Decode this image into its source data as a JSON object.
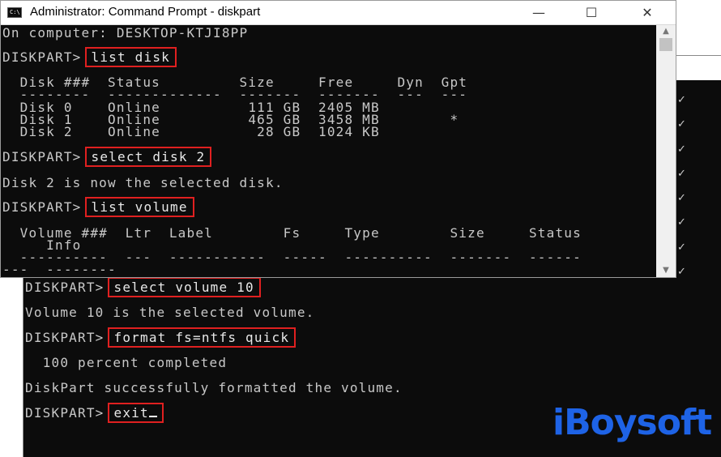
{
  "window": {
    "title": "Administrator: Command Prompt - diskpart",
    "icon_text": "C:\\"
  },
  "console": {
    "computer_line": "On computer: DESKTOP-KTJI8PP",
    "prompt": "DISKPART>",
    "cmd_list_disk": "list disk",
    "disk_table": {
      "header": "  Disk ###  Status         Size     Free     Dyn  Gpt",
      "separator": "  --------  -------------  -------  -------  ---  ---",
      "rows": [
        "  Disk 0    Online          111 GB  2405 MB",
        "  Disk 1    Online          465 GB  3458 MB        *",
        "  Disk 2    Online           28 GB  1024 KB"
      ]
    },
    "cmd_select_disk": "select disk 2",
    "msg_disk_selected": "Disk 2 is now the selected disk.",
    "cmd_list_volume": "list volume",
    "volume_table": {
      "header_1": "  Volume ###  Ltr  Label        Fs     Type        Size     Status",
      "header_2": "     Info",
      "separator_1": "  ----------  ---  -----------  -----  ----------  -------  ------",
      "separator_2": "---  --------"
    },
    "cmd_select_volume": "select volume 10",
    "msg_volume_selected": "Volume 10 is the selected volume.",
    "cmd_format": "format fs=ntfs quick",
    "msg_progress": "  100 percent completed",
    "msg_formatted": "DiskPart successfully formatted the volume.",
    "cmd_exit": "exit"
  },
  "back_window": {
    "checks": [
      "✓",
      "✓",
      "✓",
      "✓",
      "✓",
      "✓",
      "✓",
      "✓"
    ]
  },
  "logo": {
    "text": "iBoysoft"
  },
  "colors": {
    "console_bg": "#0c0c0c",
    "console_text": "#c8c8c8",
    "highlight_box": "#e02020",
    "logo": "#1e63e6"
  }
}
